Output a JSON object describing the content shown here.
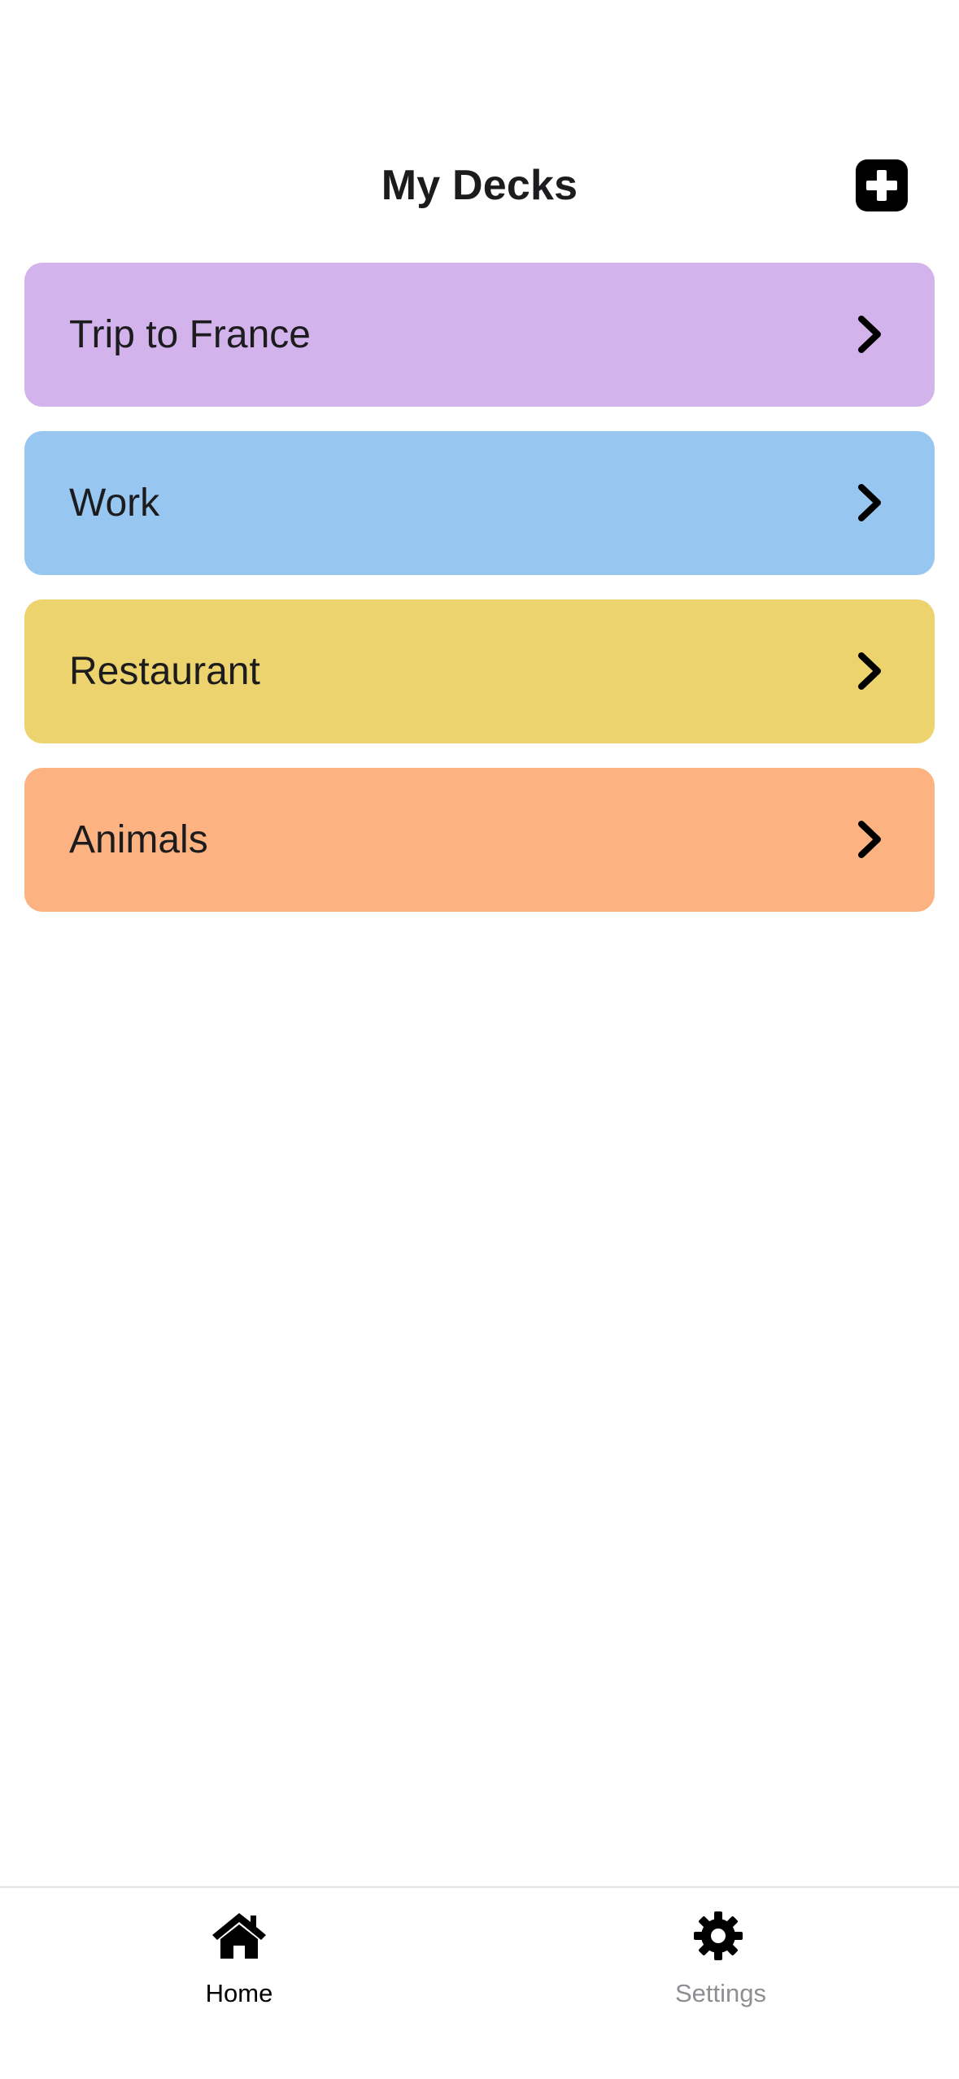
{
  "header": {
    "title": "My Decks",
    "add_icon": "plus-square-icon"
  },
  "decks": [
    {
      "label": "Trip to France",
      "color": "#d3b3ec",
      "icon": "chevron-right-icon"
    },
    {
      "label": "Work",
      "color": "#97c6f1",
      "icon": "chevron-right-icon"
    },
    {
      "label": "Restaurant",
      "color": "#edd36d",
      "icon": "chevron-right-icon"
    },
    {
      "label": "Animals",
      "color": "#fdb381",
      "icon": "chevron-right-icon"
    }
  ],
  "tab_bar": {
    "tabs": [
      {
        "label": "Home",
        "icon": "home-icon",
        "active": true,
        "color": "#000000"
      },
      {
        "label": "Settings",
        "icon": "gear-icon",
        "active": false,
        "color": "#8e8e93"
      }
    ]
  }
}
